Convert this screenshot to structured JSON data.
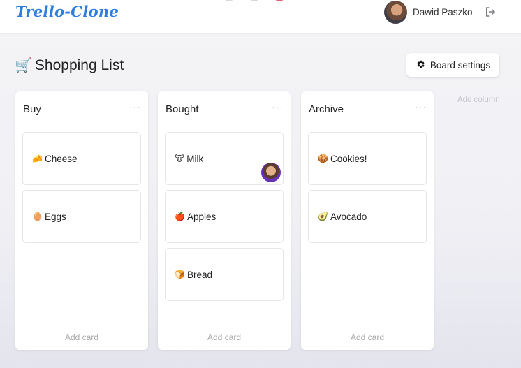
{
  "app": {
    "logo": "Trello-Clone"
  },
  "user": {
    "name": "Dawid Paszko"
  },
  "board": {
    "icon": "🛒",
    "title": "Shopping List",
    "settings_label": "Board settings",
    "add_column_label": "Add column"
  },
  "columns": [
    {
      "title": "Buy",
      "menu": "···",
      "add_card_label": "Add card",
      "cards": [
        {
          "emoji": "🧀",
          "label": "Cheese"
        },
        {
          "emoji": "🥚",
          "label": "Eggs"
        }
      ]
    },
    {
      "title": "Bought",
      "menu": "···",
      "add_card_label": "Add card",
      "cards": [
        {
          "emoji": "🐮",
          "label": "Milk"
        },
        {
          "emoji": "🍎",
          "label": "Apples"
        },
        {
          "emoji": "🍞",
          "label": "Bread"
        }
      ]
    },
    {
      "title": "Archive",
      "menu": "···",
      "add_card_label": "Add card",
      "cards": [
        {
          "emoji": "🍪",
          "label": "Cookies!"
        },
        {
          "emoji": "🥑",
          "label": "Avocado"
        }
      ]
    }
  ],
  "colors": {
    "logo": "#2f7de1",
    "card_avatar_ring": "#6a32b8"
  }
}
